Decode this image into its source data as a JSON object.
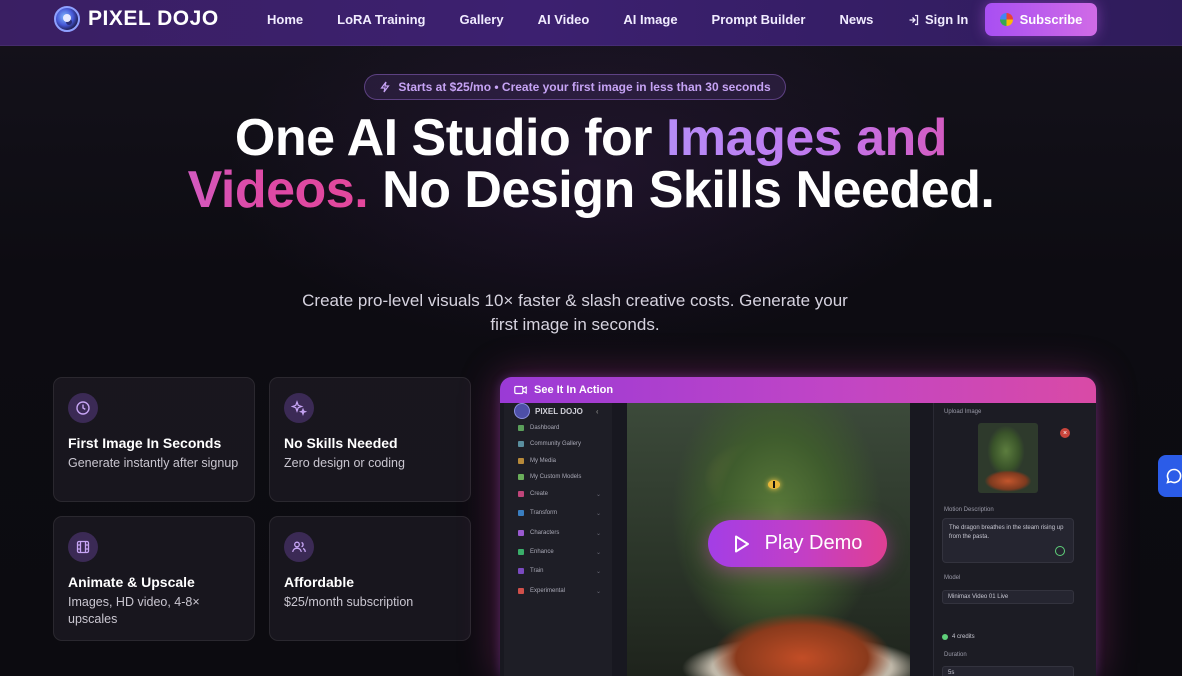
{
  "nav": {
    "brand": "PIXEL DOJO",
    "links": [
      "Home",
      "LoRA Training",
      "Gallery",
      "AI Video",
      "AI Image",
      "Prompt Builder",
      "News"
    ],
    "signin": "Sign In",
    "subscribe": "Subscribe"
  },
  "hero": {
    "pill": "Starts at $25/mo • Create your first image in less than 30 seconds",
    "headline_a": "One AI Studio for ",
    "headline_accent": "Images and Videos.",
    "headline_b": " No Design Skills Needed.",
    "subtitle": "Create pro-level visuals 10× faster & slash creative costs. Generate your first image in seconds."
  },
  "features": [
    {
      "icon": "clock-icon",
      "title": "First Image In Seconds",
      "desc": "Generate instantly after signup"
    },
    {
      "icon": "sparkles-icon",
      "title": "No Skills Needed",
      "desc": "Zero design or coding"
    },
    {
      "icon": "film-icon",
      "title": "Animate & Upscale",
      "desc": "Images, HD video, 4-8× upscales"
    },
    {
      "icon": "users-icon",
      "title": "Affordable",
      "desc": "$25/month subscription"
    }
  ],
  "demo": {
    "title": "See It In Action",
    "play": "Play Demo",
    "sidebar": {
      "brand": "PIXEL DOJO",
      "items": [
        "Dashboard",
        "Community Gallery",
        "My Media",
        "My Custom Models",
        "Create",
        "Transform",
        "Characters",
        "Enhance",
        "Train",
        "Experimental"
      ]
    },
    "panel": {
      "upload_label": "Upload Image",
      "motion_label": "Motion Description",
      "motion_text": "The dragon breathes in the steam rising up from the pasta.",
      "model_label": "Model",
      "model_value": "Minimax Video 01 Live",
      "credits": "4 credits",
      "duration_label": "Duration",
      "duration_value": "5s"
    }
  },
  "colors": {
    "accent": "#b58cf7",
    "pink": "#e3479b",
    "nav_bg": "#3a1f63"
  }
}
